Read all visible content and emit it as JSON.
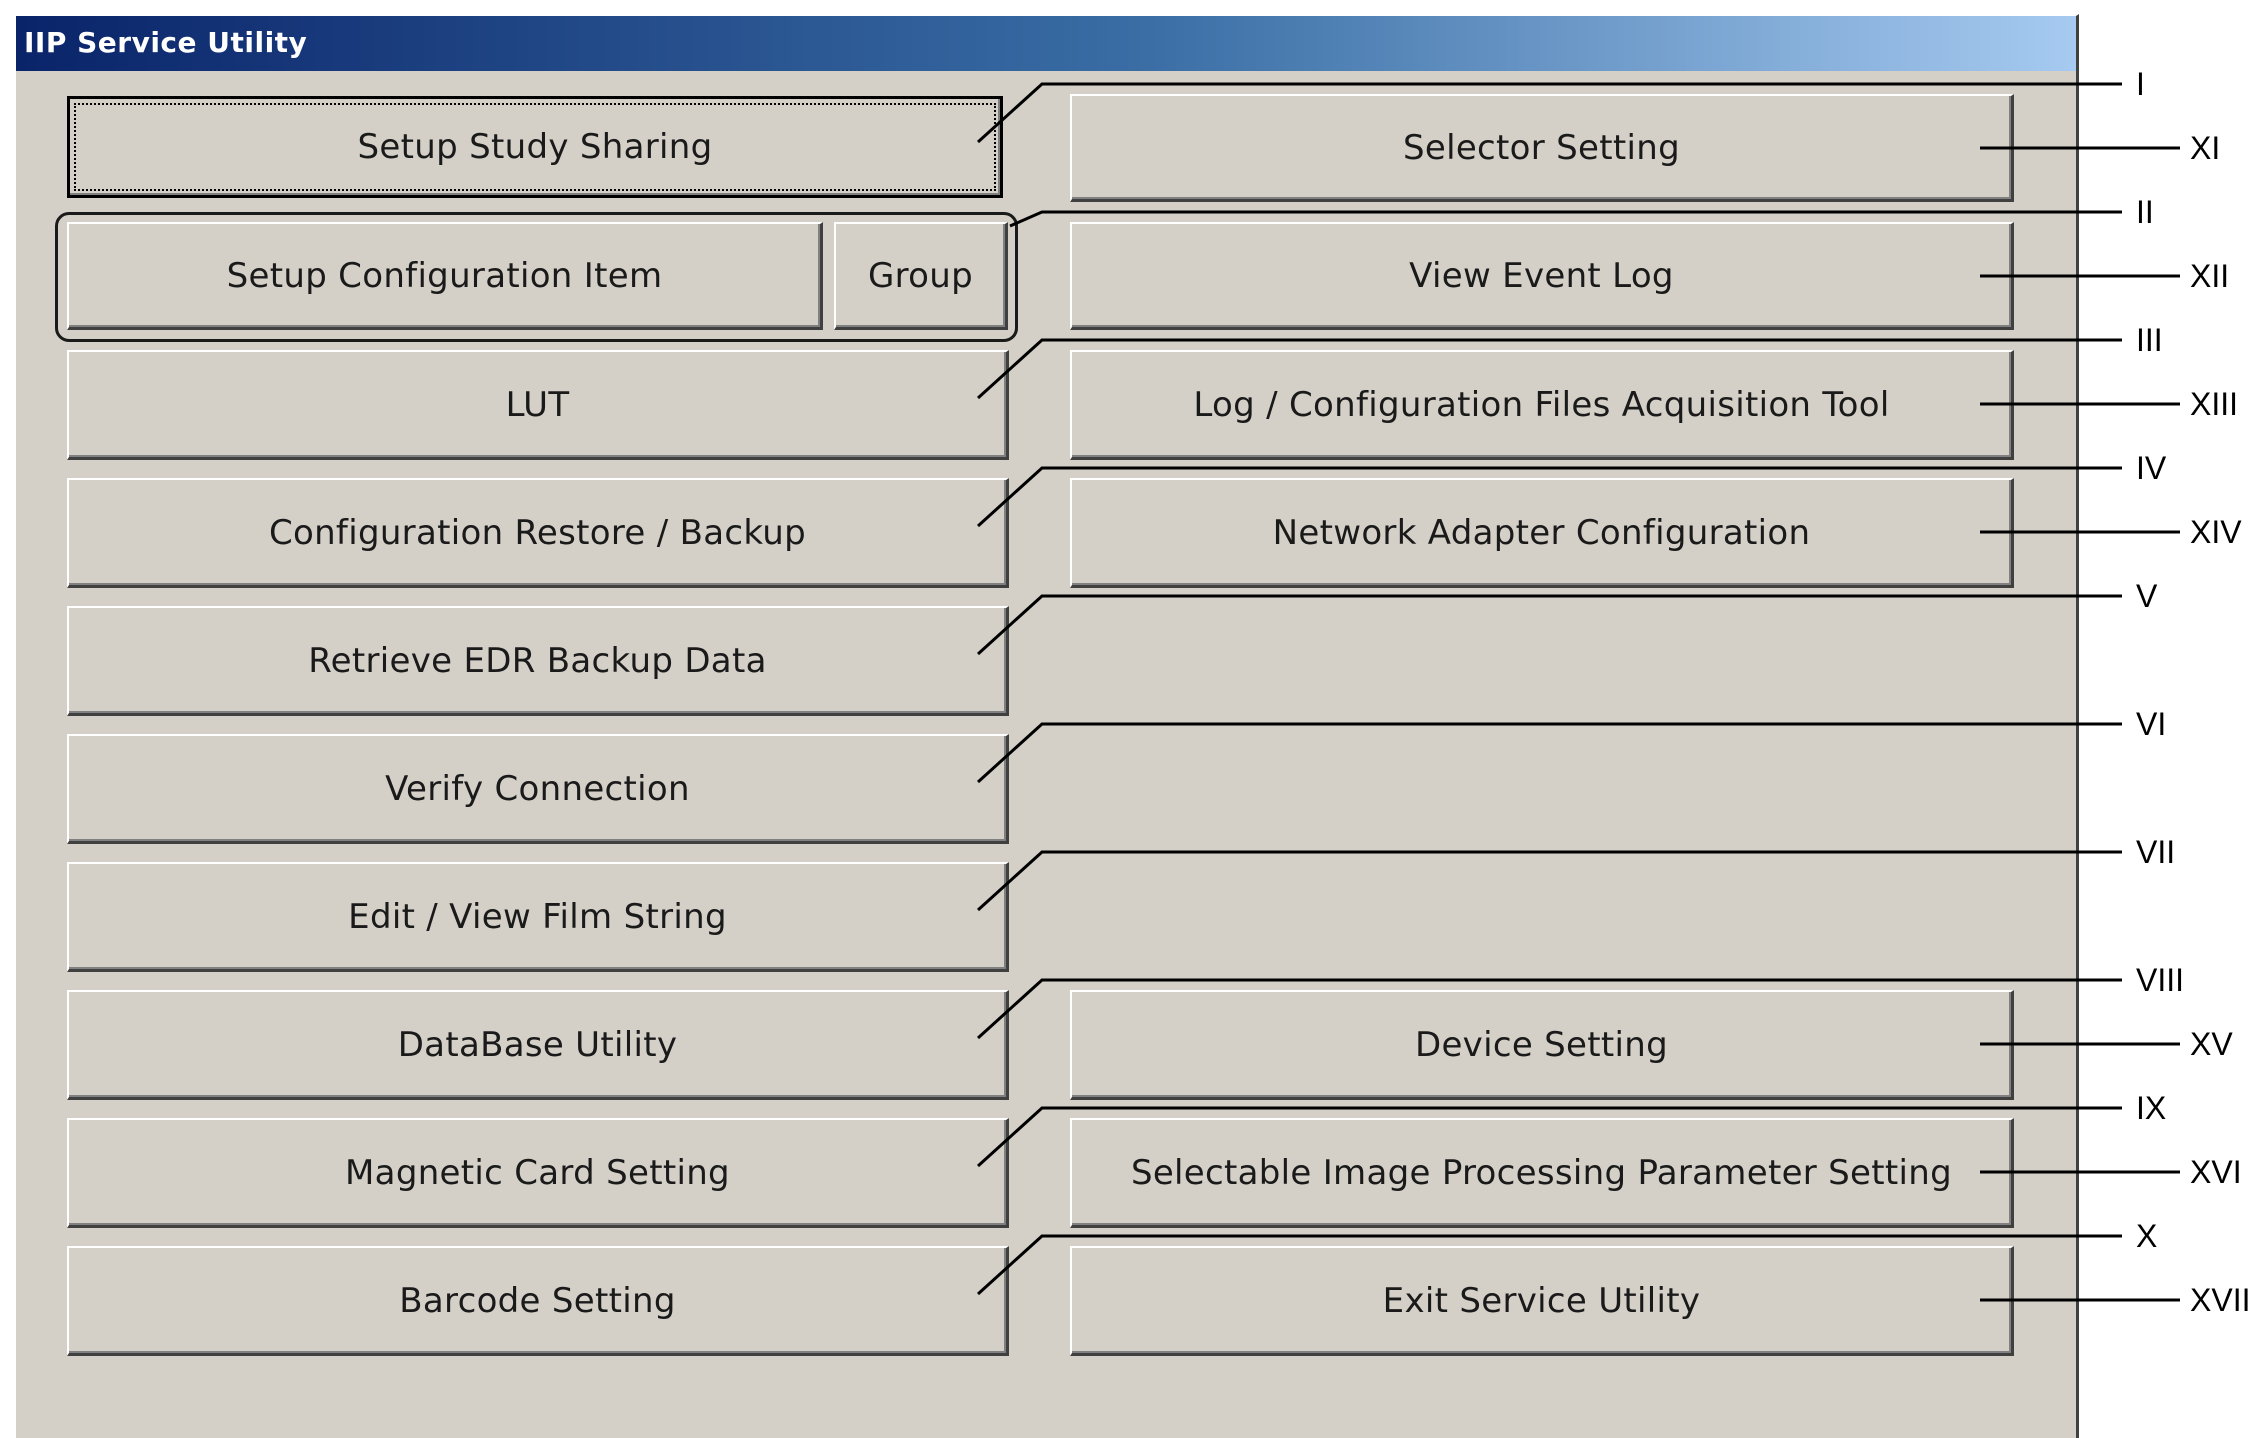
{
  "window": {
    "title": "IIP Service Utility"
  },
  "left_buttons": [
    {
      "label": "Setup Study Sharing",
      "callout": "I"
    },
    {
      "label": "Setup Configuration Item",
      "callout": "II"
    },
    {
      "label": "LUT",
      "callout": "III"
    },
    {
      "label": "Configuration Restore / Backup",
      "callout": "IV"
    },
    {
      "label": "Retrieve EDR Backup Data",
      "callout": "V"
    },
    {
      "label": "Verify Connection",
      "callout": "VI"
    },
    {
      "label": "Edit / View Film String",
      "callout": "VII"
    },
    {
      "label": "DataBase Utility",
      "callout": "VIII"
    },
    {
      "label": "Magnetic Card Setting",
      "callout": "IX"
    },
    {
      "label": "Barcode Setting",
      "callout": "X"
    }
  ],
  "group_button": {
    "label": "Group"
  },
  "right_buttons": [
    {
      "label": "Selector Setting",
      "callout": "XI"
    },
    {
      "label": "View Event Log",
      "callout": "XII"
    },
    {
      "label": "Log / Configuration Files Acquisition Tool",
      "callout": "XIII"
    },
    {
      "label": "Network Adapter Configuration",
      "callout": "XIV"
    },
    {
      "label": "Device Setting",
      "callout": "XV"
    },
    {
      "label": "Selectable Image Processing Parameter Setting",
      "callout": "XVI"
    },
    {
      "label": "Exit Service Utility",
      "callout": "XVII"
    }
  ]
}
